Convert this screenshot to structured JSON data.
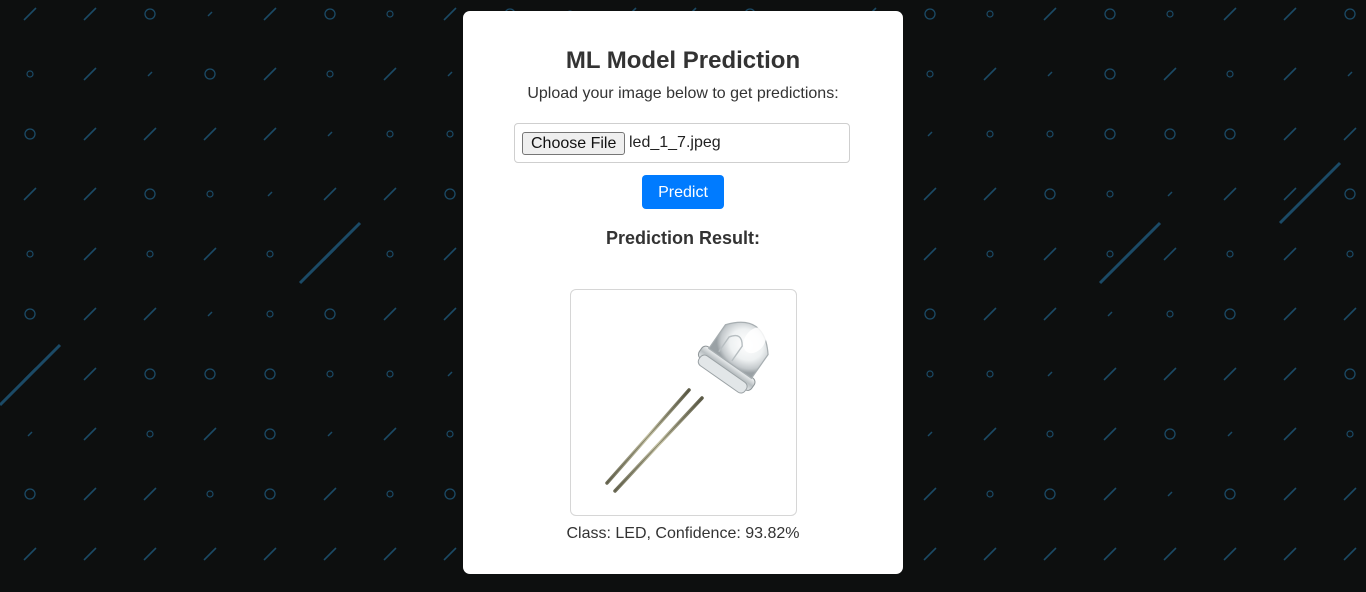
{
  "page": {
    "title": "ML Model Prediction",
    "subtitle": "Upload your image below to get predictions:"
  },
  "upload": {
    "choose_label": "Choose File",
    "file_name": "led_1_7.jpeg"
  },
  "predict_button": {
    "label": "Predict"
  },
  "result": {
    "heading": "Prediction Result:",
    "image_icon": "led-icon",
    "class_prefix": "Class: ",
    "class_value": "LED",
    "confidence_prefix": ", Confidence: ",
    "confidence_value": "93.82%"
  },
  "colors": {
    "background": "#0d0f0f",
    "pattern": "#1b4a66",
    "card": "#ffffff",
    "accent": "#007bff"
  }
}
